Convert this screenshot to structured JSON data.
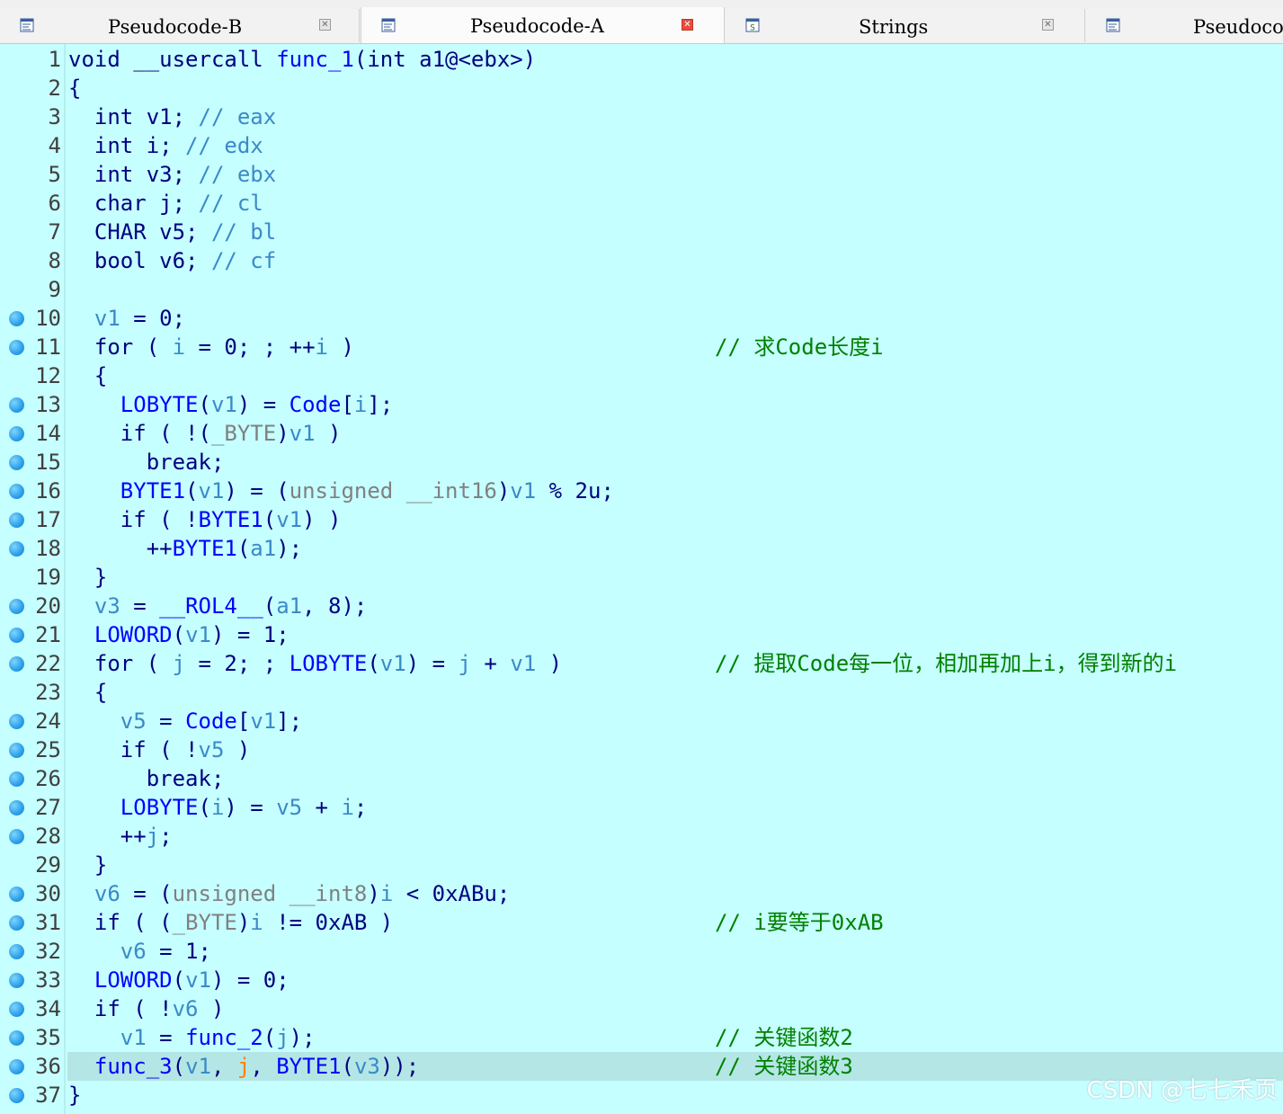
{
  "tabs": [
    {
      "label": "Pseudocode-B",
      "icon": "pseudocode-icon",
      "active": false
    },
    {
      "label": "Pseudocode-A",
      "icon": "pseudocode-icon",
      "active": true
    },
    {
      "label": "Strings",
      "icon": "strings-icon",
      "active": false
    },
    {
      "label": "Pseudocode-C",
      "icon": "pseudocode-icon",
      "active": false
    }
  ],
  "colors": {
    "background": "#c6ffff",
    "keyword": "#000080",
    "function": "#0000ff",
    "variable": "#3a8ac8",
    "number": "#008000",
    "comment": "#008000",
    "highlight": "#b4e6e6",
    "breakpoint": "#2a9ee8"
  },
  "lines": [
    {
      "n": "1",
      "bp": false,
      "tokens": [
        [
          "k",
          "void __usercall "
        ],
        [
          "f",
          "func_1"
        ],
        [
          "o",
          "(int a1@<ebx>)"
        ]
      ],
      "comment": ""
    },
    {
      "n": "2",
      "bp": false,
      "tokens": [
        [
          "o",
          "{"
        ]
      ],
      "comment": ""
    },
    {
      "n": "3",
      "bp": false,
      "tokens": [
        [
          "o",
          "  int v1; "
        ],
        [
          "c",
          "// eax"
        ]
      ],
      "comment": ""
    },
    {
      "n": "4",
      "bp": false,
      "tokens": [
        [
          "o",
          "  int i; "
        ],
        [
          "c",
          "// edx"
        ]
      ],
      "comment": ""
    },
    {
      "n": "5",
      "bp": false,
      "tokens": [
        [
          "o",
          "  int v3; "
        ],
        [
          "c",
          "// ebx"
        ]
      ],
      "comment": ""
    },
    {
      "n": "6",
      "bp": false,
      "tokens": [
        [
          "o",
          "  char j; "
        ],
        [
          "c",
          "// cl"
        ]
      ],
      "comment": ""
    },
    {
      "n": "7",
      "bp": false,
      "tokens": [
        [
          "o",
          "  CHAR v5; "
        ],
        [
          "c",
          "// bl"
        ]
      ],
      "comment": ""
    },
    {
      "n": "8",
      "bp": false,
      "tokens": [
        [
          "o",
          "  bool v6; "
        ],
        [
          "c",
          "// cf"
        ]
      ],
      "comment": ""
    },
    {
      "n": "9",
      "bp": false,
      "tokens": [],
      "comment": ""
    },
    {
      "n": "10",
      "bp": true,
      "tokens": [
        [
          "o",
          "  "
        ],
        [
          "v",
          "v1"
        ],
        [
          "o",
          " = "
        ],
        [
          "o",
          "0;"
        ]
      ],
      "comment": ""
    },
    {
      "n": "11",
      "bp": true,
      "tokens": [
        [
          "o",
          "  for ( "
        ],
        [
          "v",
          "i"
        ],
        [
          "o",
          " = 0; ; ++"
        ],
        [
          "v",
          "i"
        ],
        [
          "o",
          " )"
        ]
      ],
      "comment": "// 求Code长度i"
    },
    {
      "n": "12",
      "bp": false,
      "tokens": [
        [
          "o",
          "  {"
        ]
      ],
      "comment": ""
    },
    {
      "n": "13",
      "bp": true,
      "tokens": [
        [
          "o",
          "    "
        ],
        [
          "f",
          "LOBYTE"
        ],
        [
          "o",
          "("
        ],
        [
          "v",
          "v1"
        ],
        [
          "o",
          ") = "
        ],
        [
          "f",
          "Code"
        ],
        [
          "o",
          "["
        ],
        [
          "v",
          "i"
        ],
        [
          "o",
          "];"
        ]
      ],
      "comment": ""
    },
    {
      "n": "14",
      "bp": true,
      "tokens": [
        [
          "o",
          "    if ( !("
        ],
        [
          "x",
          "_BYTE"
        ],
        [
          "o",
          ")"
        ],
        [
          "v",
          "v1"
        ],
        [
          "o",
          " )"
        ]
      ],
      "comment": ""
    },
    {
      "n": "15",
      "bp": true,
      "tokens": [
        [
          "o",
          "      break;"
        ]
      ],
      "comment": ""
    },
    {
      "n": "16",
      "bp": true,
      "tokens": [
        [
          "o",
          "    "
        ],
        [
          "f",
          "BYTE1"
        ],
        [
          "o",
          "("
        ],
        [
          "v",
          "v1"
        ],
        [
          "o",
          ") = ("
        ],
        [
          "x",
          "unsigned __int16"
        ],
        [
          "o",
          ")"
        ],
        [
          "v",
          "v1"
        ],
        [
          "o",
          " % 2u;"
        ]
      ],
      "comment": ""
    },
    {
      "n": "17",
      "bp": true,
      "tokens": [
        [
          "o",
          "    if ( !"
        ],
        [
          "f",
          "BYTE1"
        ],
        [
          "o",
          "("
        ],
        [
          "v",
          "v1"
        ],
        [
          "o",
          ") )"
        ]
      ],
      "comment": ""
    },
    {
      "n": "18",
      "bp": true,
      "tokens": [
        [
          "o",
          "      ++"
        ],
        [
          "f",
          "BYTE1"
        ],
        [
          "o",
          "("
        ],
        [
          "v",
          "a1"
        ],
        [
          "o",
          ");"
        ]
      ],
      "comment": ""
    },
    {
      "n": "19",
      "bp": false,
      "tokens": [
        [
          "o",
          "  }"
        ]
      ],
      "comment": ""
    },
    {
      "n": "20",
      "bp": true,
      "tokens": [
        [
          "o",
          "  "
        ],
        [
          "v",
          "v3"
        ],
        [
          "o",
          " = "
        ],
        [
          "f",
          "__ROL4__"
        ],
        [
          "o",
          "("
        ],
        [
          "v",
          "a1"
        ],
        [
          "o",
          ", 8);"
        ]
      ],
      "comment": ""
    },
    {
      "n": "21",
      "bp": true,
      "tokens": [
        [
          "o",
          "  "
        ],
        [
          "f",
          "LOWORD"
        ],
        [
          "o",
          "("
        ],
        [
          "v",
          "v1"
        ],
        [
          "o",
          ") = 1;"
        ]
      ],
      "comment": ""
    },
    {
      "n": "22",
      "bp": true,
      "tokens": [
        [
          "o",
          "  for ( "
        ],
        [
          "v",
          "j"
        ],
        [
          "o",
          " = 2; ; "
        ],
        [
          "f",
          "LOBYTE"
        ],
        [
          "o",
          "("
        ],
        [
          "v",
          "v1"
        ],
        [
          "o",
          ") = "
        ],
        [
          "v",
          "j"
        ],
        [
          "o",
          " + "
        ],
        [
          "v",
          "v1"
        ],
        [
          "o",
          " )"
        ]
      ],
      "comment": "// 提取Code每一位，相加再加上i，得到新的i"
    },
    {
      "n": "23",
      "bp": false,
      "tokens": [
        [
          "o",
          "  {"
        ]
      ],
      "comment": ""
    },
    {
      "n": "24",
      "bp": true,
      "tokens": [
        [
          "o",
          "    "
        ],
        [
          "v",
          "v5"
        ],
        [
          "o",
          " = "
        ],
        [
          "f",
          "Code"
        ],
        [
          "o",
          "["
        ],
        [
          "v",
          "v1"
        ],
        [
          "o",
          "];"
        ]
      ],
      "comment": ""
    },
    {
      "n": "25",
      "bp": true,
      "tokens": [
        [
          "o",
          "    if ( !"
        ],
        [
          "v",
          "v5"
        ],
        [
          "o",
          " )"
        ]
      ],
      "comment": ""
    },
    {
      "n": "26",
      "bp": true,
      "tokens": [
        [
          "o",
          "      break;"
        ]
      ],
      "comment": ""
    },
    {
      "n": "27",
      "bp": true,
      "tokens": [
        [
          "o",
          "    "
        ],
        [
          "f",
          "LOBYTE"
        ],
        [
          "o",
          "("
        ],
        [
          "v",
          "i"
        ],
        [
          "o",
          ") = "
        ],
        [
          "v",
          "v5"
        ],
        [
          "o",
          " + "
        ],
        [
          "v",
          "i"
        ],
        [
          "o",
          ";"
        ]
      ],
      "comment": ""
    },
    {
      "n": "28",
      "bp": true,
      "tokens": [
        [
          "o",
          "    ++"
        ],
        [
          "v",
          "j"
        ],
        [
          "o",
          ";"
        ]
      ],
      "comment": ""
    },
    {
      "n": "29",
      "bp": false,
      "tokens": [
        [
          "o",
          "  }"
        ]
      ],
      "comment": ""
    },
    {
      "n": "30",
      "bp": true,
      "tokens": [
        [
          "o",
          "  "
        ],
        [
          "v",
          "v6"
        ],
        [
          "o",
          " = ("
        ],
        [
          "x",
          "unsigned __int8"
        ],
        [
          "o",
          ")"
        ],
        [
          "v",
          "i"
        ],
        [
          "o",
          " < 0xABu;"
        ]
      ],
      "comment": ""
    },
    {
      "n": "31",
      "bp": true,
      "tokens": [
        [
          "o",
          "  if ( ("
        ],
        [
          "x",
          "_BYTE"
        ],
        [
          "o",
          ")"
        ],
        [
          "v",
          "i"
        ],
        [
          "o",
          " != 0xAB )"
        ]
      ],
      "comment": "// i要等于0xAB"
    },
    {
      "n": "32",
      "bp": true,
      "tokens": [
        [
          "o",
          "    "
        ],
        [
          "v",
          "v6"
        ],
        [
          "o",
          " = 1;"
        ]
      ],
      "comment": ""
    },
    {
      "n": "33",
      "bp": true,
      "tokens": [
        [
          "o",
          "  "
        ],
        [
          "f",
          "LOWORD"
        ],
        [
          "o",
          "("
        ],
        [
          "v",
          "v1"
        ],
        [
          "o",
          ") = 0;"
        ]
      ],
      "comment": ""
    },
    {
      "n": "34",
      "bp": true,
      "tokens": [
        [
          "o",
          "  if ( !"
        ],
        [
          "v",
          "v6"
        ],
        [
          "o",
          " )"
        ]
      ],
      "comment": ""
    },
    {
      "n": "35",
      "bp": true,
      "tokens": [
        [
          "o",
          "    "
        ],
        [
          "v",
          "v1"
        ],
        [
          "o",
          " = "
        ],
        [
          "f",
          "func_2"
        ],
        [
          "o",
          "("
        ],
        [
          "v",
          "j"
        ],
        [
          "o",
          ");"
        ]
      ],
      "comment": "// 关键函数2"
    },
    {
      "n": "36",
      "bp": true,
      "hl": true,
      "tokens": [
        [
          "o",
          "  "
        ],
        [
          "f",
          "func_3"
        ],
        [
          "o",
          "("
        ],
        [
          "v",
          "v1"
        ],
        [
          "o",
          ", "
        ],
        [
          "y",
          "j"
        ],
        [
          "o",
          ", "
        ],
        [
          "f",
          "BYTE1"
        ],
        [
          "o",
          "("
        ],
        [
          "v",
          "v3"
        ],
        [
          "o",
          "));"
        ]
      ],
      "comment": "// 关键函数3"
    },
    {
      "n": "37",
      "bp": true,
      "tokens": [
        [
          "o",
          "}"
        ]
      ],
      "comment": ""
    }
  ],
  "watermark": "CSDN @七七禾页"
}
